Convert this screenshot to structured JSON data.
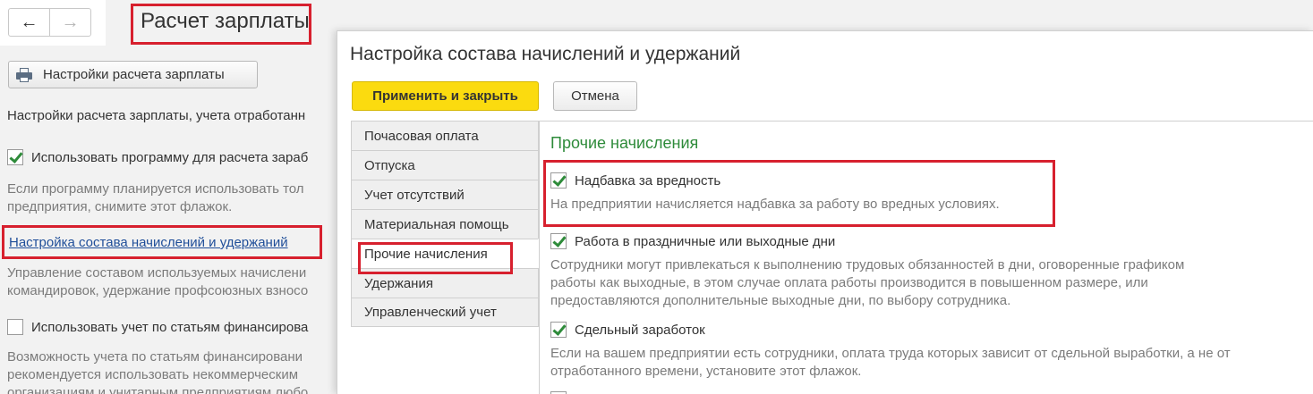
{
  "nav": {
    "back_icon": "←",
    "forward_icon": "→"
  },
  "page": {
    "title": "Расчет зарплаты",
    "settings_button": "Настройки расчета зарплаты",
    "intro": "Настройки расчета зарплаты, учета отработанн",
    "use_program_label": "Использовать программу для расчета зараб",
    "use_program_desc": [
      "Если программу планируется использовать тол",
      "предприятия, снимите этот флажок."
    ],
    "link": "Настройка состава начислений и удержаний",
    "link_desc": [
      "Управление составом используемых начислени",
      "командировок, удержание профсоюзных взносо"
    ],
    "financing_label": "Использовать учет по статьям финансирова",
    "financing_desc": [
      "Возможность учета по статьям финансировани",
      "рекомендуется использовать некоммерческим",
      "организациям и унитарным предприятиям любо"
    ]
  },
  "dialog": {
    "title": "Настройка состава начислений и удержаний",
    "apply_button": "Применить и закрыть",
    "cancel_button": "Отмена",
    "tabs": [
      "Почасовая оплата",
      "Отпуска",
      "Учет отсутствий",
      "Материальная помощь",
      "Прочие начисления",
      "Удержания",
      "Управленческий учет"
    ],
    "active_tab": "Прочие начисления",
    "section_title": "Прочие начисления",
    "options": [
      {
        "label": "Надбавка за вредность",
        "checked": true,
        "desc": [
          "На предприятии начисляется надбавка за работу во вредных условиях."
        ]
      },
      {
        "label": "Работа в праздничные или выходные дни",
        "checked": true,
        "desc": [
          "Сотрудники могут привлекаться к выполнению трудовых обязанностей в дни, оговоренные графиком",
          "работы как выходные, в этом случае оплата работы производится в повышенном размере, или",
          "предоставляются дополнительные выходные дни, по выбору сотрудника."
        ]
      },
      {
        "label": "Сдельный заработок",
        "checked": true,
        "desc": [
          "Если на вашем предприятии есть сотрудники, оплата труда которых зависит от сдельной выработки, а не от",
          "отработанного времени, установите этот флажок."
        ]
      }
    ]
  },
  "colors": {
    "highlight": "#d7202e",
    "accent_green": "#2e8b3a",
    "apply_yellow": "#fbdb0f",
    "link_blue": "#1f4e99"
  },
  "icons": {
    "print": "printer-icon",
    "checkbox": "checkbox-icon"
  }
}
